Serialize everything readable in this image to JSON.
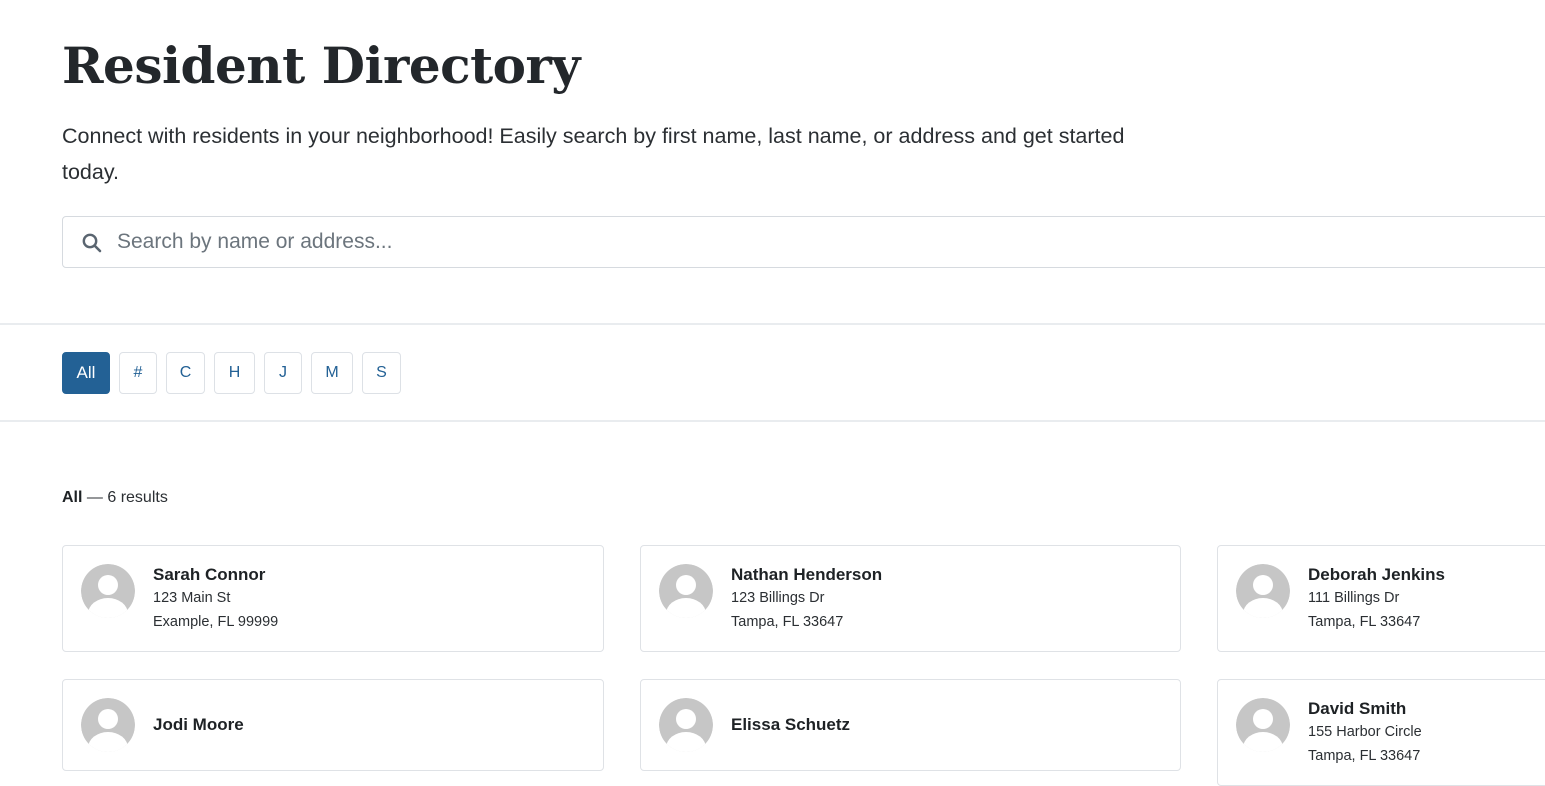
{
  "header": {
    "title": "Resident Directory",
    "description": "Connect with residents in your neighborhood! Easily search by first name, last name, or address and get started today."
  },
  "search": {
    "icon": "search-icon",
    "placeholder": "Search by name or address...",
    "value": ""
  },
  "filters": {
    "active": "All",
    "items": [
      {
        "label": "All",
        "active": true
      },
      {
        "label": "#",
        "active": false
      },
      {
        "label": "C",
        "active": false
      },
      {
        "label": "H",
        "active": false
      },
      {
        "label": "J",
        "active": false
      },
      {
        "label": "M",
        "active": false
      },
      {
        "label": "S",
        "active": false
      }
    ]
  },
  "results": {
    "filter_label": "All",
    "separator": " — ",
    "count_text": "6 results"
  },
  "residents": [
    {
      "name": "Sarah Connor",
      "address_line1": "123 Main St",
      "address_line2": "Example, FL 99999"
    },
    {
      "name": "Nathan Henderson",
      "address_line1": "123 Billings Dr",
      "address_line2": "Tampa, FL 33647"
    },
    {
      "name": "Deborah Jenkins",
      "address_line1": "111 Billings Dr",
      "address_line2": "Tampa, FL 33647"
    },
    {
      "name": "Jodi Moore",
      "address_line1": null,
      "address_line2": null
    },
    {
      "name": "Elissa Schuetz",
      "address_line1": null,
      "address_line2": null
    },
    {
      "name": "David Smith",
      "address_line1": "155 Harbor Circle",
      "address_line2": "Tampa, FL 33647"
    }
  ],
  "colors": {
    "accent": "#236195",
    "text": "#23272b",
    "border": "#dfe2e6",
    "divider": "#e9ecef",
    "avatar_bg": "#c6c6c6"
  }
}
